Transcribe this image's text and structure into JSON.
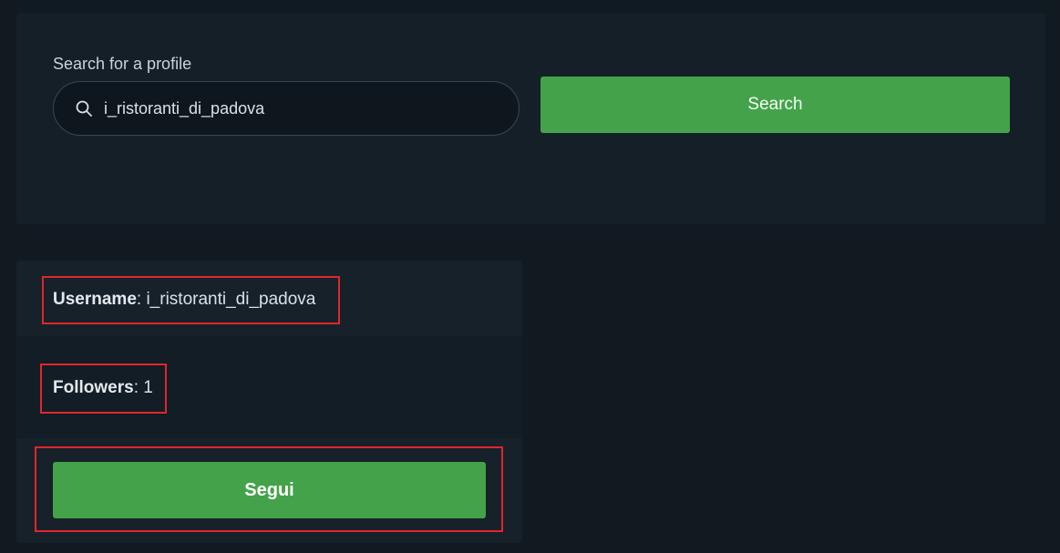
{
  "search": {
    "label": "Search for a profile",
    "value": "i_ristoranti_di_padova",
    "button_label": "Search",
    "icon": "search-icon"
  },
  "profile": {
    "username_label": "Username",
    "username_value": "i_ristoranti_di_padova",
    "followers_label": "Followers",
    "followers_value": "1",
    "follow_button_label": "Segui"
  },
  "colors": {
    "background": "#111a21",
    "panel": "#151f28",
    "accent_green": "#44a34a",
    "highlight_red": "#e0262d"
  }
}
